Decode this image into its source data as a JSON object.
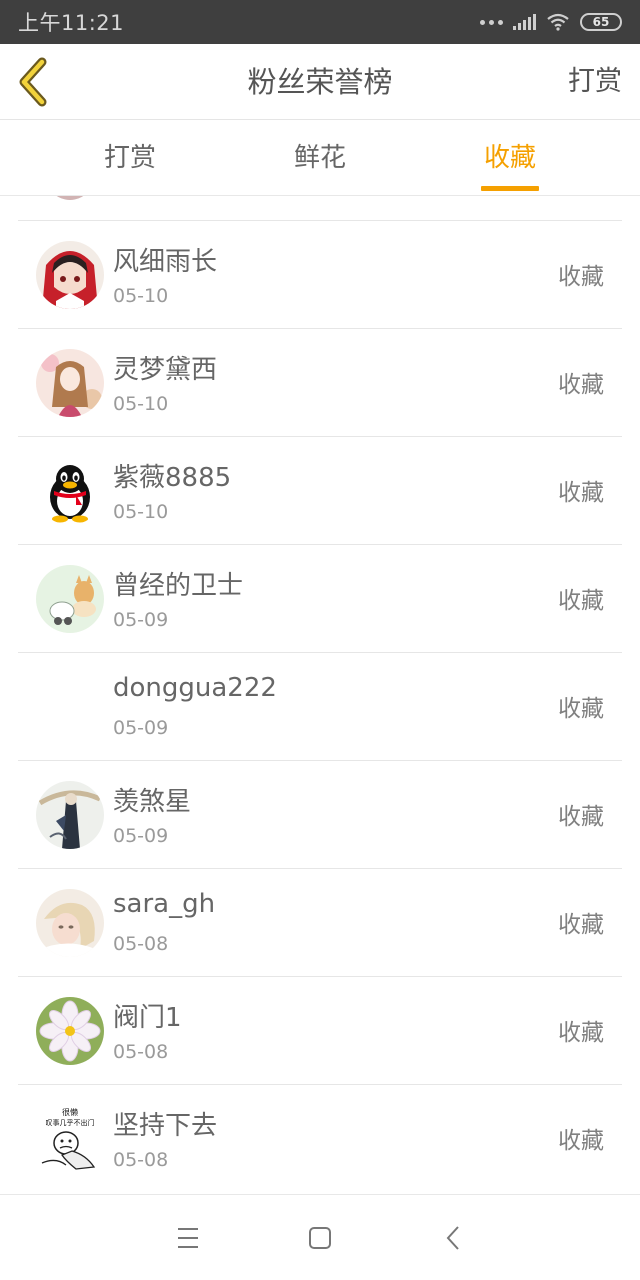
{
  "status_bar": {
    "time": "上午11:21",
    "battery": "65"
  },
  "header": {
    "title": "粉丝荣誉榜",
    "reward_link": "打赏"
  },
  "tabs": [
    {
      "label": "打赏",
      "active": false
    },
    {
      "label": "鲜花",
      "active": false
    },
    {
      "label": "收藏",
      "active": true
    }
  ],
  "accent_color": "#f5a000",
  "list": [
    {
      "name": "风细雨长",
      "date": "05-10",
      "action": "收藏"
    },
    {
      "name": "灵梦黛西",
      "date": "05-10",
      "action": "收藏"
    },
    {
      "name": "紫薇8885",
      "date": "05-10",
      "action": "收藏"
    },
    {
      "name": "曾经的卫士",
      "date": "05-09",
      "action": "收藏"
    },
    {
      "name": "donggua222",
      "date": "05-09",
      "action": "收藏"
    },
    {
      "name": "羡煞星",
      "date": "05-09",
      "action": "收藏"
    },
    {
      "name": "sara_gh",
      "date": "05-08",
      "action": "收藏"
    },
    {
      "name": "阀门1",
      "date": "05-08",
      "action": "收藏"
    },
    {
      "name": "坚持下去",
      "date": "05-08",
      "action": "收藏"
    }
  ],
  "meme_avatar_text": {
    "line1": "很懒",
    "line2": "叹事几乎不出门"
  },
  "nav": {
    "icons": [
      "menu-icon",
      "home-icon",
      "back-icon"
    ]
  }
}
